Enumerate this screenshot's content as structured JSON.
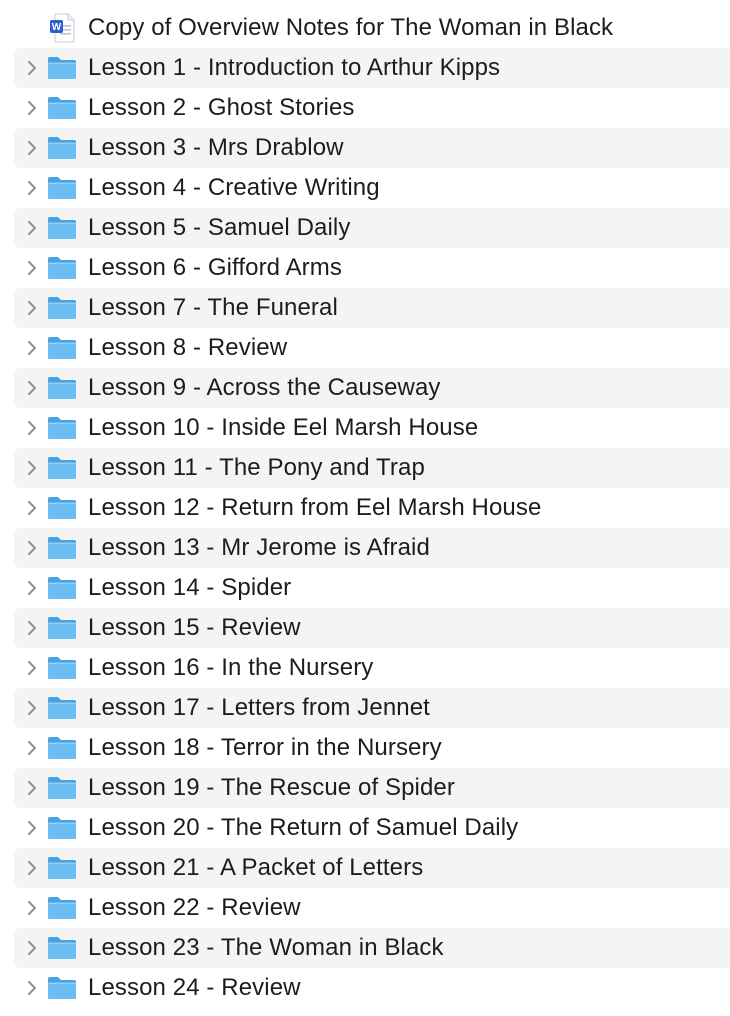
{
  "colors": {
    "folder_front": "#6bbdf2",
    "folder_back": "#4aa3e0",
    "row_alt": "#f4f4f5",
    "text": "#1d1d1f",
    "chevron": "#8e8e93",
    "word_blue": "#2b5fd0"
  },
  "items": [
    {
      "type": "document",
      "icon": "word-document-icon",
      "name": "Copy of Overview Notes for The Woman in Black"
    },
    {
      "type": "folder",
      "icon": "folder-icon",
      "name": "Lesson 1 - Introduction to Arthur Kipps"
    },
    {
      "type": "folder",
      "icon": "folder-icon",
      "name": "Lesson 2 - Ghost Stories"
    },
    {
      "type": "folder",
      "icon": "folder-icon",
      "name": "Lesson 3 - Mrs Drablow"
    },
    {
      "type": "folder",
      "icon": "folder-icon",
      "name": "Lesson 4 - Creative Writing"
    },
    {
      "type": "folder",
      "icon": "folder-icon",
      "name": "Lesson 5 - Samuel Daily"
    },
    {
      "type": "folder",
      "icon": "folder-icon",
      "name": "Lesson 6 - Gifford Arms"
    },
    {
      "type": "folder",
      "icon": "folder-icon",
      "name": "Lesson 7 - The Funeral"
    },
    {
      "type": "folder",
      "icon": "folder-icon",
      "name": "Lesson 8 - Review"
    },
    {
      "type": "folder",
      "icon": "folder-icon",
      "name": "Lesson 9 - Across the Causeway"
    },
    {
      "type": "folder",
      "icon": "folder-icon",
      "name": "Lesson 10 - Inside Eel Marsh House"
    },
    {
      "type": "folder",
      "icon": "folder-icon",
      "name": "Lesson 11 - The Pony and Trap"
    },
    {
      "type": "folder",
      "icon": "folder-icon",
      "name": "Lesson 12 - Return from Eel Marsh House"
    },
    {
      "type": "folder",
      "icon": "folder-icon",
      "name": "Lesson 13 - Mr Jerome is Afraid"
    },
    {
      "type": "folder",
      "icon": "folder-icon",
      "name": "Lesson 14 - Spider"
    },
    {
      "type": "folder",
      "icon": "folder-icon",
      "name": "Lesson 15 - Review"
    },
    {
      "type": "folder",
      "icon": "folder-icon",
      "name": "Lesson 16 - In the Nursery"
    },
    {
      "type": "folder",
      "icon": "folder-icon",
      "name": "Lesson 17 - Letters from Jennet"
    },
    {
      "type": "folder",
      "icon": "folder-icon",
      "name": "Lesson 18 - Terror in the Nursery"
    },
    {
      "type": "folder",
      "icon": "folder-icon",
      "name": "Lesson 19 - The Rescue of Spider"
    },
    {
      "type": "folder",
      "icon": "folder-icon",
      "name": "Lesson 20 - The Return of Samuel Daily"
    },
    {
      "type": "folder",
      "icon": "folder-icon",
      "name": "Lesson 21 - A Packet of Letters"
    },
    {
      "type": "folder",
      "icon": "folder-icon",
      "name": "Lesson 22 - Review"
    },
    {
      "type": "folder",
      "icon": "folder-icon",
      "name": "Lesson 23 - The Woman in Black"
    },
    {
      "type": "folder",
      "icon": "folder-icon",
      "name": "Lesson 24 - Review"
    }
  ]
}
